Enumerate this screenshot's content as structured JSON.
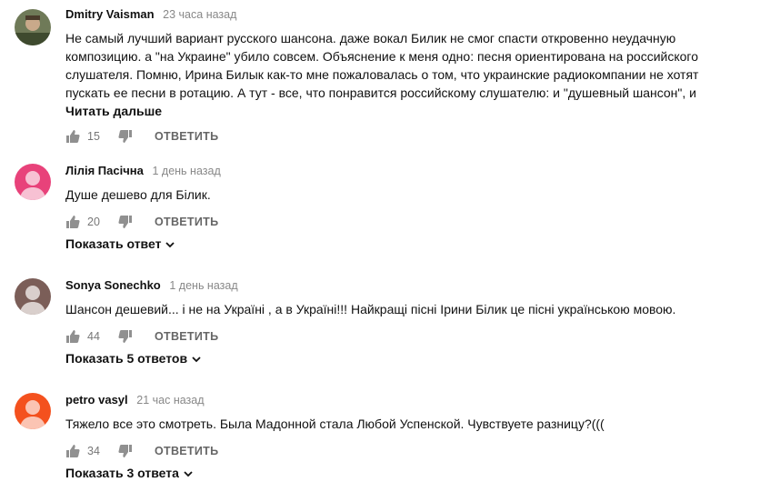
{
  "comments": [
    {
      "author": "Dmitry Vaisman",
      "time": "23 часа назад",
      "text": "Не самый лучший вариант русского шансона. даже вокал Билик не смог спасти откровенно неудачную композицию. а \"на Украине\" убило совсем. Объяснение к меня одно: песня ориентирована на российского слушателя. Помню, Ирина Билык как-то мне пожаловалась о том, что украинские радиокомпании не хотят пускать ее песни в ротацию. А тут - все, что понравится российскому слушателю: и \"душевный шансон\", и",
      "read_more": "Читать дальше",
      "likes": "15",
      "reply": "ОТВЕТИТЬ",
      "avatar_color": "#6f7a58"
    },
    {
      "author": "Лілія Пасічна",
      "time": "1 день назад",
      "text": "Душе дешево для Білик.",
      "likes": "20",
      "reply": "ОТВЕТИТЬ",
      "show_replies": "Показать ответ",
      "avatar_color": "#e8427a"
    },
    {
      "author": "Sonya Sonechko",
      "time": "1 день назад",
      "text": "Шансон дешевий... і не на Україні , а в Україні!!! Найкращі пісні Ірини Білик це пісні українською мовою.",
      "likes": "44",
      "reply": "ОТВЕТИТЬ",
      "show_replies": "Показать 5 ответов",
      "avatar_color": "#7b5e58"
    },
    {
      "author": "petro vasyl",
      "time": "21 час назад",
      "text": "Тяжело все это смотреть. Была Мадонной стала Любой Успенской. Чувствуете разницу?(((",
      "likes": "34",
      "reply": "ОТВЕТИТЬ",
      "show_replies": "Показать 3 ответа",
      "avatar_color": "#f4511e"
    }
  ]
}
